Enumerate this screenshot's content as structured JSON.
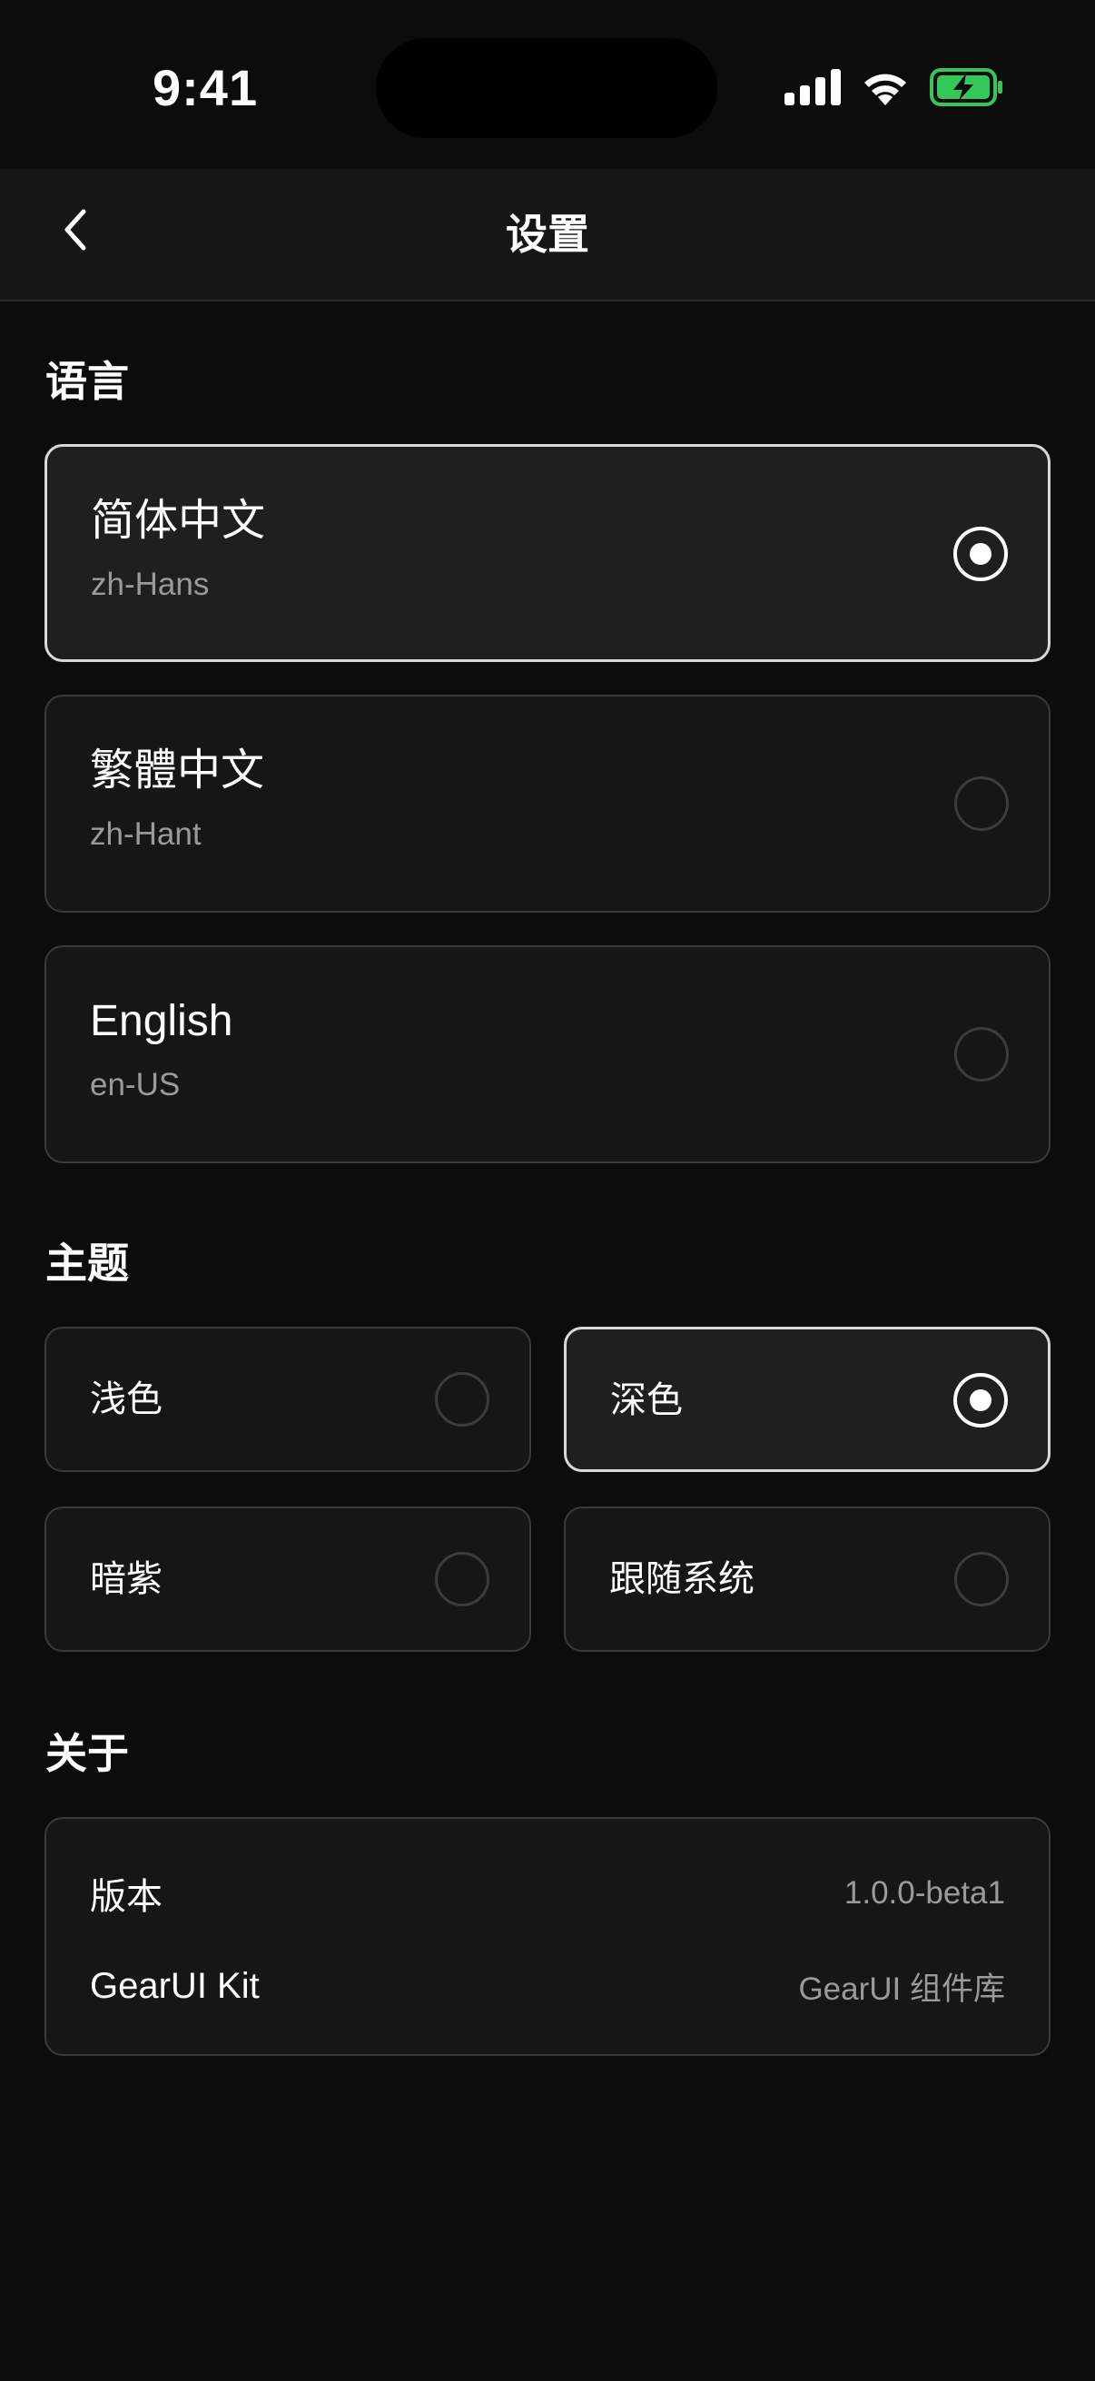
{
  "status_bar": {
    "time": "9:41",
    "icons": [
      "cellular-signal-icon",
      "wifi-icon",
      "battery-charging-icon"
    ],
    "battery_color": "#34c759"
  },
  "nav": {
    "title": "设置",
    "back_icon": "chevron-left-icon"
  },
  "language": {
    "title": "语言",
    "options": [
      {
        "name": "简体中文",
        "code": "zh-Hans",
        "selected": true
      },
      {
        "name": "繁體中文",
        "code": "zh-Hant",
        "selected": false
      },
      {
        "name": "English",
        "code": "en-US",
        "selected": false
      }
    ]
  },
  "theme": {
    "title": "主题",
    "options": [
      {
        "label": "浅色",
        "selected": false
      },
      {
        "label": "深色",
        "selected": true
      },
      {
        "label": "暗紫",
        "selected": false
      },
      {
        "label": "跟随系统",
        "selected": false
      }
    ]
  },
  "about": {
    "title": "关于",
    "rows": [
      {
        "key": "版本",
        "value": "1.0.0-beta1"
      },
      {
        "key": "GearUI Kit",
        "value": "GearUI 组件库"
      }
    ]
  },
  "colors": {
    "background": "#0c0c0c",
    "card": "#161616",
    "selected_card": "#1f1f1f",
    "selected_border": "#d8d8d8",
    "secondary_text": "#9a9a9a"
  }
}
